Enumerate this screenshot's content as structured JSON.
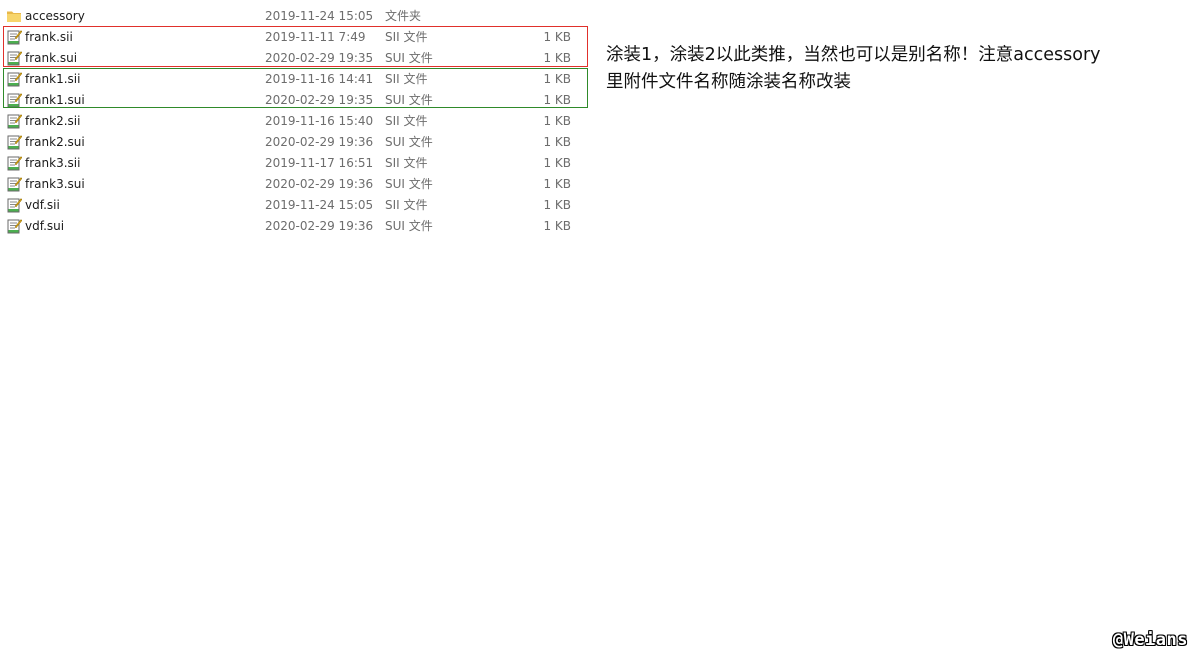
{
  "files": [
    {
      "name": "accessory",
      "date": "2019-11-24 15:05",
      "type": "文件夹",
      "size": "",
      "icon": "folder-icon"
    },
    {
      "name": "frank.sii",
      "date": "2019-11-11 7:49",
      "type": "SII 文件",
      "size": "1 KB",
      "icon": "text-file-icon"
    },
    {
      "name": "frank.sui",
      "date": "2020-02-29 19:35",
      "type": "SUI 文件",
      "size": "1 KB",
      "icon": "text-file-icon"
    },
    {
      "name": "frank1.sii",
      "date": "2019-11-16 14:41",
      "type": "SII 文件",
      "size": "1 KB",
      "icon": "text-file-icon"
    },
    {
      "name": "frank1.sui",
      "date": "2020-02-29 19:35",
      "type": "SUI 文件",
      "size": "1 KB",
      "icon": "text-file-icon"
    },
    {
      "name": "frank2.sii",
      "date": "2019-11-16 15:40",
      "type": "SII 文件",
      "size": "1 KB",
      "icon": "text-file-icon"
    },
    {
      "name": "frank2.sui",
      "date": "2020-02-29 19:36",
      "type": "SUI 文件",
      "size": "1 KB",
      "icon": "text-file-icon"
    },
    {
      "name": "frank3.sii",
      "date": "2019-11-17 16:51",
      "type": "SII 文件",
      "size": "1 KB",
      "icon": "text-file-icon"
    },
    {
      "name": "frank3.sui",
      "date": "2020-02-29 19:36",
      "type": "SUI 文件",
      "size": "1 KB",
      "icon": "text-file-icon"
    },
    {
      "name": "vdf.sii",
      "date": "2019-11-24 15:05",
      "type": "SII 文件",
      "size": "1 KB",
      "icon": "text-file-icon"
    },
    {
      "name": "vdf.sui",
      "date": "2020-02-29 19:36",
      "type": "SUI 文件",
      "size": "1 KB",
      "icon": "text-file-icon"
    }
  ],
  "highlights": {
    "red_color": "#e0302b",
    "green_color": "#2f8a2a"
  },
  "annotation": {
    "line1": "涂装1，涂装2以此类推，当然也可以是别名称！注意accessory",
    "line2": "里附件文件名称随涂装名称改装"
  },
  "watermark": {
    "text": "@Weians"
  }
}
